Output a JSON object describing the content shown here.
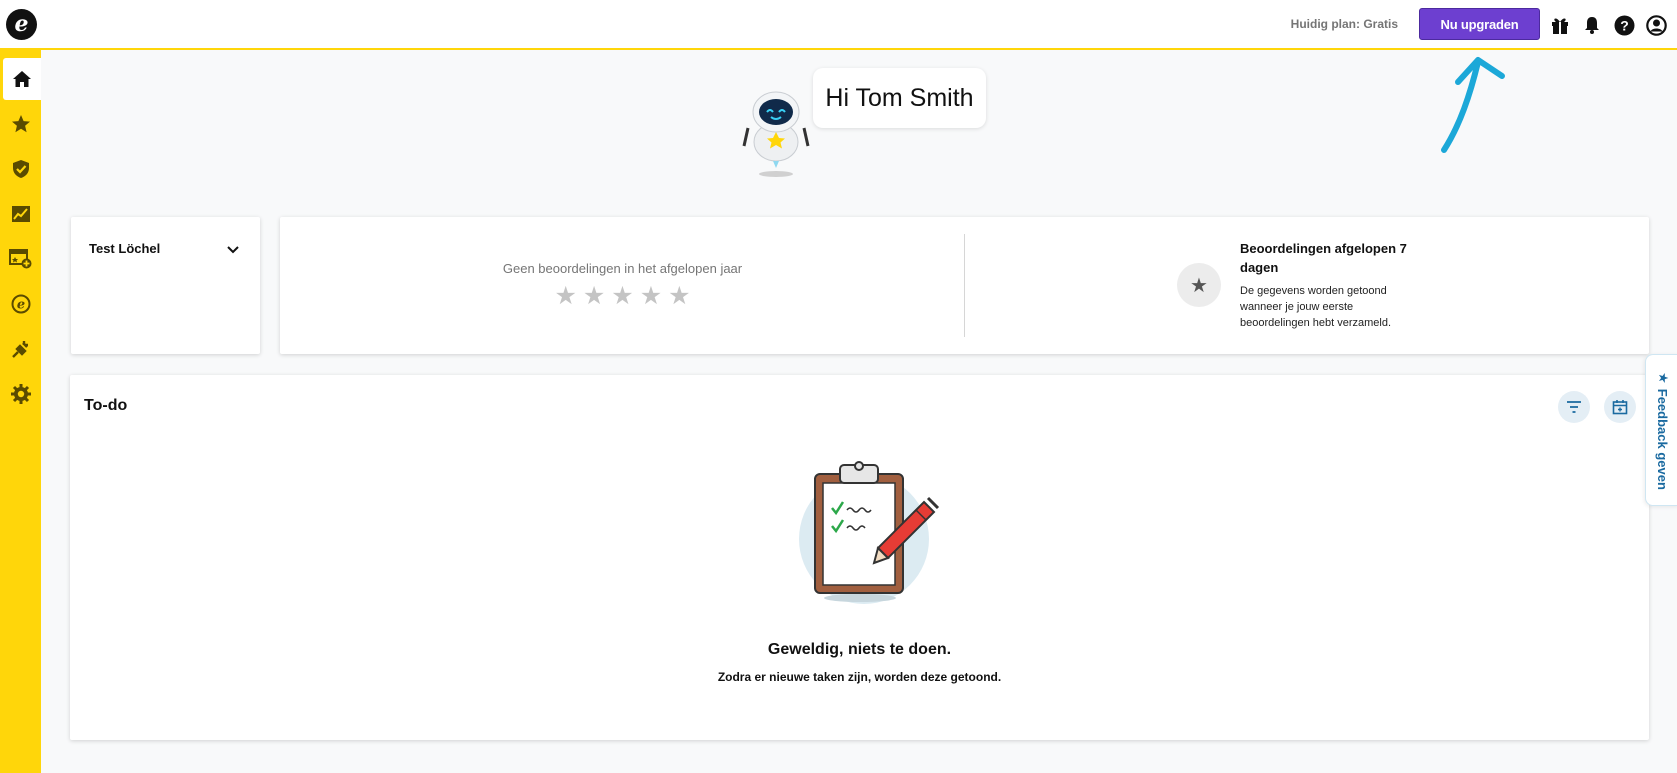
{
  "topbar": {
    "logo_glyph": "e",
    "plan_text": "Huidig plan: Gratis",
    "upgrade_label": "Nu upgraden",
    "icons": [
      "gift-icon",
      "bell-icon",
      "help-icon",
      "account-icon"
    ]
  },
  "sidebar": {
    "items": [
      {
        "icon": "home-icon",
        "active": true
      },
      {
        "icon": "star-icon",
        "active": false
      },
      {
        "icon": "shield-check-icon",
        "active": false
      },
      {
        "icon": "chart-icon",
        "active": false
      },
      {
        "icon": "widget-add-icon",
        "active": false
      },
      {
        "icon": "brand-e-icon",
        "active": false
      },
      {
        "icon": "plug-icon",
        "active": false
      },
      {
        "icon": "settings-icon",
        "active": false
      }
    ]
  },
  "greeting": {
    "text": "Hi Tom Smith"
  },
  "location": {
    "name": "Test Löchel"
  },
  "ratings": {
    "empty_label": "Geen beoordelingen in het afgelopen jaar",
    "stars_filled": 0,
    "stars_total": 5,
    "star_glyph": "★",
    "period_title": "Beoordelingen afgelopen 7 dagen",
    "period_desc": "De gegevens worden getoond wanneer je jouw eerste beoordelingen hebt verzameld."
  },
  "todo": {
    "title": "To-do",
    "empty_title": "Geweldig, niets te doen.",
    "empty_sub": "Zodra er nieuwe taken zijn, worden deze getoond.",
    "actions": [
      "filter-icon",
      "calendar-icon"
    ]
  },
  "feedback": {
    "glyph": "★",
    "label": "Feedback geven"
  },
  "colors": {
    "brand_yellow": "#ffd60a",
    "upgrade_purple": "#6d3fd0",
    "annotation_blue": "#1ca8d8"
  }
}
